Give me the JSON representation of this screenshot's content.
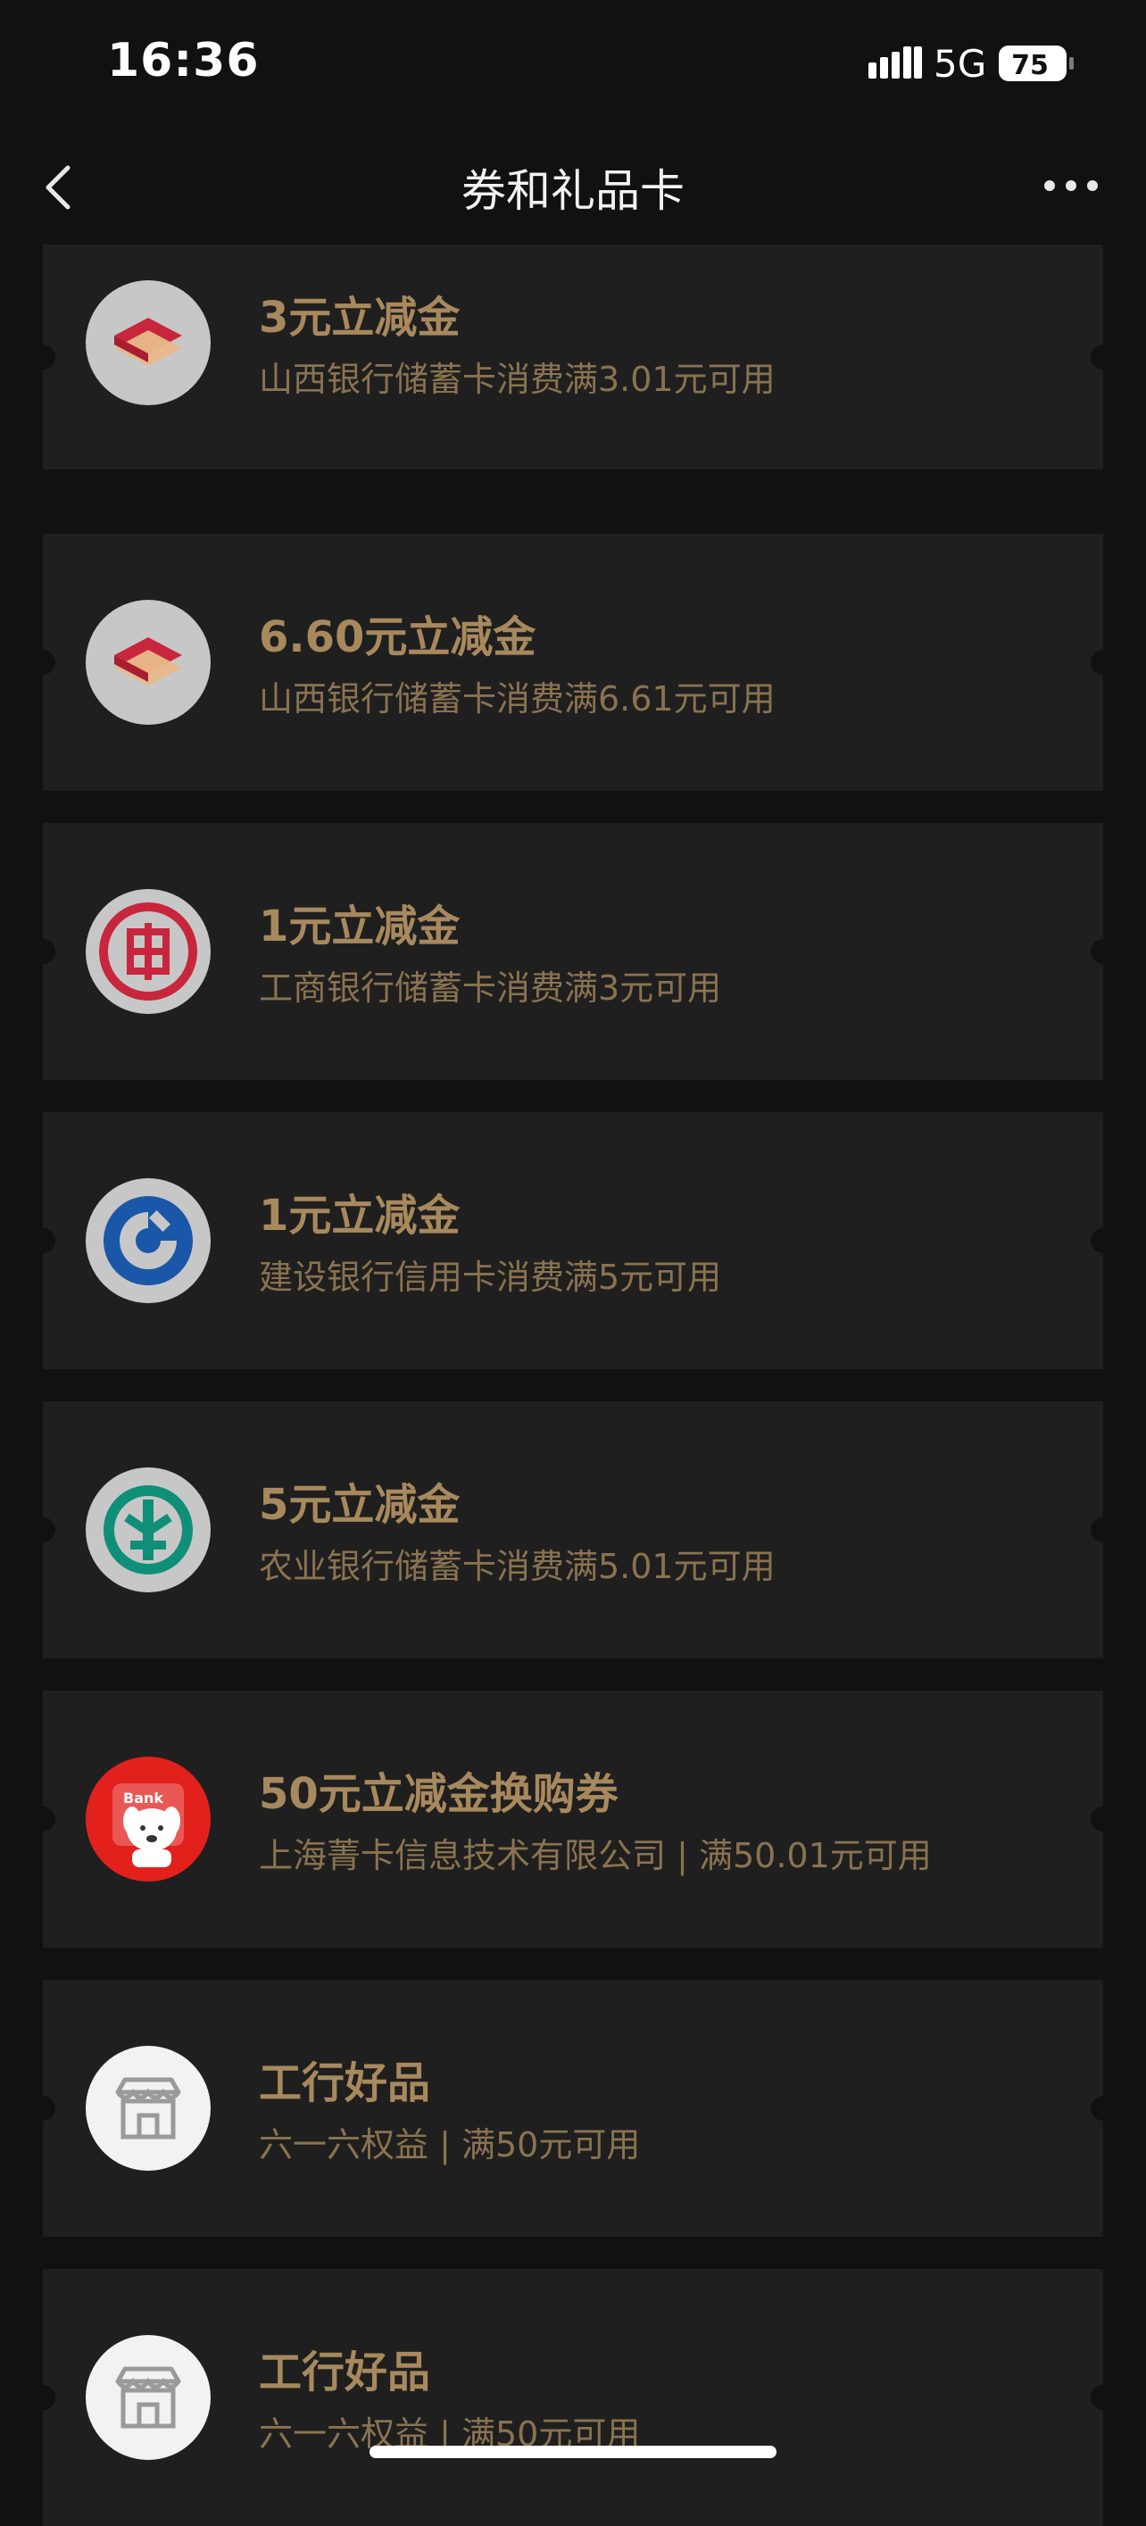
{
  "status_bar": {
    "time": "16:36",
    "network": "5G",
    "battery": "75"
  },
  "nav": {
    "title": "券和礼品卡",
    "back_icon": "chevron-left-icon",
    "more_icon": "more-dots-icon"
  },
  "colors": {
    "background": "#111111",
    "card": "#1f1f1f",
    "title_gold": "#a8895d",
    "desc_gold": "#8a7350"
  },
  "coupons": [
    {
      "logo": "shanxi-bank-logo",
      "title": "3元立减金",
      "desc": "山西银行储蓄卡消费满3.01元可用"
    },
    {
      "logo": "shanxi-bank-logo",
      "title": "6.60元立减金",
      "desc": "山西银行储蓄卡消费满6.61元可用"
    },
    {
      "logo": "icbc-logo",
      "title": "1元立减金",
      "desc": "工商银行储蓄卡消费满3元可用"
    },
    {
      "logo": "ccb-logo",
      "title": "1元立减金",
      "desc": "建设银行信用卡消费满5元可用"
    },
    {
      "logo": "abc-logo",
      "title": "5元立减金",
      "desc": "农业银行储蓄卡消费满5.01元可用"
    },
    {
      "logo": "jd-bank-logo",
      "logo_text": "Bank",
      "title": "50元立减金换购券",
      "desc": "上海菁卡信息技术有限公司 | 满50.01元可用"
    },
    {
      "logo": "store-icon",
      "title": "工行好品",
      "desc": "六一六权益 | 满50元可用"
    },
    {
      "logo": "store-icon",
      "title": "工行好品",
      "desc": "六一六权益 | 满50元可用"
    }
  ]
}
